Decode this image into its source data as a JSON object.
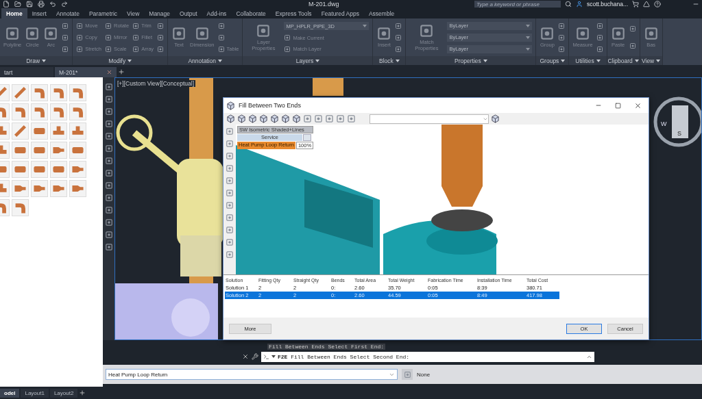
{
  "window": {
    "title": "M-201.dwg"
  },
  "search": {
    "placeholder": "Type a keyword or phrase"
  },
  "user": {
    "name": "scott.buchana..."
  },
  "ribbon_tabs": [
    {
      "label": "Home",
      "selected": true
    },
    {
      "label": "Insert",
      "selected": false
    },
    {
      "label": "Annotate",
      "selected": false
    },
    {
      "label": "Parametric",
      "selected": false
    },
    {
      "label": "View",
      "selected": false
    },
    {
      "label": "Manage",
      "selected": false
    },
    {
      "label": "Output",
      "selected": false
    },
    {
      "label": "Add-ins",
      "selected": false
    },
    {
      "label": "Collaborate",
      "selected": false
    },
    {
      "label": "Express Tools",
      "selected": false
    },
    {
      "label": "Featured Apps",
      "selected": false
    },
    {
      "label": "Assemble",
      "selected": false
    }
  ],
  "ribbon_panels": [
    {
      "title": "Draw",
      "columns": [
        [
          {
            "kind": "large",
            "label": "Polyline"
          }
        ],
        [
          {
            "kind": "large",
            "label": "Circle"
          }
        ],
        [
          {
            "kind": "large",
            "label": "Arc"
          }
        ],
        [
          {
            "kind": "icon"
          },
          {
            "kind": "icon"
          },
          {
            "kind": "icon"
          }
        ]
      ]
    },
    {
      "title": "Modify",
      "columns": [
        [
          {
            "kind": "small",
            "label": "Move"
          },
          {
            "kind": "small",
            "label": "Copy"
          },
          {
            "kind": "small",
            "label": "Stretch"
          }
        ],
        [
          {
            "kind": "small",
            "label": "Rotate"
          },
          {
            "kind": "small",
            "label": "Mirror"
          },
          {
            "kind": "small",
            "label": "Scale"
          }
        ],
        [
          {
            "kind": "small",
            "label": "Trim"
          },
          {
            "kind": "small",
            "label": "Fillet"
          },
          {
            "kind": "small",
            "label": "Array"
          }
        ],
        [
          {
            "kind": "icon"
          },
          {
            "kind": "icon"
          },
          {
            "kind": "icon"
          }
        ]
      ]
    },
    {
      "title": "Annotation",
      "columns": [
        [
          {
            "kind": "large",
            "label": "Text"
          }
        ],
        [
          {
            "kind": "large",
            "label": "Dimension"
          }
        ],
        [
          {
            "kind": "icon"
          },
          {
            "kind": "icon"
          },
          {
            "kind": "small",
            "label": "Table"
          }
        ]
      ]
    },
    {
      "title": "Layers",
      "columns": [
        [
          {
            "kind": "large",
            "label": "Layer Properties"
          }
        ],
        [
          {
            "kind": "dropdown",
            "label": "MP_HPLR_PIPE_3D"
          },
          {
            "kind": "small",
            "label": "Make Current"
          },
          {
            "kind": "small",
            "label": "Match Layer"
          }
        ]
      ]
    },
    {
      "title": "Block",
      "columns": [
        [
          {
            "kind": "large",
            "label": "Insert"
          }
        ],
        [
          {
            "kind": "icon"
          },
          {
            "kind": "icon"
          },
          {
            "kind": "icon"
          }
        ]
      ]
    },
    {
      "title": "Properties",
      "columns": [
        [
          {
            "kind": "large",
            "label": "Match Properties"
          }
        ],
        [
          {
            "kind": "dropdown",
            "label": "ByLayer"
          },
          {
            "kind": "dropdown",
            "label": "ByLayer"
          },
          {
            "kind": "dropdown",
            "label": "ByLayer"
          }
        ]
      ]
    },
    {
      "title": "Groups",
      "columns": [
        [
          {
            "kind": "large",
            "label": "Group"
          }
        ],
        [
          {
            "kind": "icon"
          },
          {
            "kind": "icon"
          },
          {
            "kind": "icon"
          }
        ]
      ]
    },
    {
      "title": "Utilities",
      "columns": [
        [
          {
            "kind": "large",
            "label": "Measure"
          }
        ],
        [
          {
            "kind": "icon"
          },
          {
            "kind": "icon"
          },
          {
            "kind": "icon"
          }
        ]
      ]
    },
    {
      "title": "Clipboard",
      "columns": [
        [
          {
            "kind": "large",
            "label": "Paste"
          }
        ],
        [
          {
            "kind": "icon"
          },
          {
            "kind": "icon"
          }
        ]
      ]
    },
    {
      "title": "View",
      "columns": [
        [
          {
            "kind": "large",
            "label": "Bas"
          }
        ]
      ]
    }
  ],
  "document_tabs": [
    {
      "label": "tart",
      "selected": false,
      "closable": false
    },
    {
      "label": "M-201*",
      "selected": true,
      "closable": true
    }
  ],
  "palette": {
    "items": [
      {
        "kind": "pipe"
      },
      {
        "kind": "pipe"
      },
      {
        "kind": "elbow"
      },
      {
        "kind": "elbow"
      },
      {
        "kind": "elbow"
      },
      {
        "kind": "elbow"
      },
      {
        "kind": "elbow"
      },
      {
        "kind": "elbow"
      },
      {
        "kind": "elbow"
      },
      {
        "kind": "elbow"
      },
      {
        "kind": "tee"
      },
      {
        "kind": "pipe"
      },
      {
        "kind": "coupling"
      },
      {
        "kind": "tee"
      },
      {
        "kind": "tee"
      },
      {
        "kind": "tee"
      },
      {
        "kind": "coupling"
      },
      {
        "kind": "coupling"
      },
      {
        "kind": "reducer"
      },
      {
        "kind": "coupling"
      },
      {
        "kind": "coupling"
      },
      {
        "kind": "coupling"
      },
      {
        "kind": "coupling"
      },
      {
        "kind": "coupling"
      },
      {
        "kind": "reducer"
      },
      {
        "kind": "tee"
      },
      {
        "kind": "reducer"
      },
      {
        "kind": "reducer"
      },
      {
        "kind": "reducer"
      },
      {
        "kind": "reducer"
      },
      {
        "kind": "elbow"
      },
      {
        "kind": "elbow"
      }
    ]
  },
  "viewport": {
    "label": "[+][Custom View][Conceptual]",
    "viewcube": [
      "W",
      "S"
    ]
  },
  "dialog": {
    "title": "Fill Between Two Ends",
    "legend": {
      "view": "SW Isometric Shaded+Lines",
      "group": "Service",
      "group_checked": false,
      "service": "Heat Pump Loop Return",
      "zoom": "100%"
    },
    "table": {
      "columns": [
        "Solution",
        "Fitting Qty",
        "Straight Qty",
        "Bends",
        "Total Area",
        "Total Weight",
        "Fabrication Time",
        "Installation Time",
        "Total Cost"
      ],
      "rows": [
        {
          "selected": false,
          "cells": [
            "Solution 1",
            "2",
            "2",
            "0:",
            "2.60",
            "35.70",
            "0:05",
            "8:39",
            "380.71"
          ]
        },
        {
          "selected": true,
          "cells": [
            "Solution 2",
            "2",
            "2",
            "0:",
            "2.60",
            "44.59",
            "0:05",
            "8:49",
            "417.98"
          ]
        }
      ]
    },
    "buttons": [
      {
        "label": "More",
        "kind": "extra"
      },
      {
        "label": "OK",
        "kind": "default"
      },
      {
        "label": "Cancel",
        "kind": "cancel"
      }
    ]
  },
  "command_line": {
    "history": "Fill Between Ends Select First End:",
    "prompt": "**F2E** Fill Between Ends Select Second End:"
  },
  "properties_bar": {
    "service": "Heat Pump Loop Return",
    "value": "None"
  },
  "layout_tabs": [
    {
      "label": "odel",
      "selected": true
    },
    {
      "label": "Layout1",
      "selected": false
    },
    {
      "label": "Layout2",
      "selected": false
    }
  ]
}
